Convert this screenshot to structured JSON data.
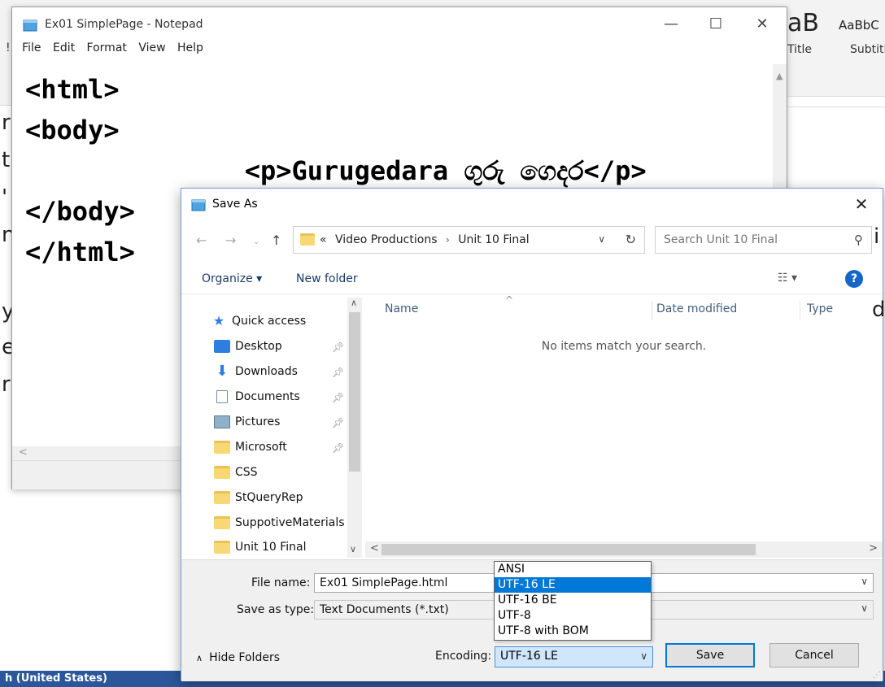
{
  "word": {
    "style_preview_1": "aB",
    "style_preview_2": "AaBbC",
    "style_name_1": "Title",
    "style_name_2": "Subtitl",
    "status_text": "h (United States)",
    "left_frags": [
      "r",
      "t",
      "'",
      "n",
      "y",
      "e",
      "r"
    ],
    "right_frags": [
      "i",
      "d"
    ]
  },
  "notepad": {
    "title": "Ex01 SimplePage - Notepad",
    "menu": [
      "File",
      "Edit",
      "Format",
      "View",
      "Help"
    ],
    "menu_marker": "!",
    "content_lines": [
      "<html>",
      "<body>",
      "              <p>Gurugedara ගුරු ගෙදර</p>",
      "</body>",
      "</html>"
    ]
  },
  "dialog": {
    "title": "Save As",
    "address": {
      "prefix": "«",
      "crumbs": [
        "Video Productions",
        "Unit 10 Final"
      ]
    },
    "search_placeholder": "Search Unit 10 Final",
    "toolbar": {
      "organize": "Organize ▾",
      "new_folder": "New folder",
      "help": "?"
    },
    "nav_items": [
      {
        "label": "Quick access",
        "icon": "star-icon",
        "pinned": false
      },
      {
        "label": "Desktop",
        "icon": "desktop-icon",
        "pinned": true
      },
      {
        "label": "Downloads",
        "icon": "download-icon",
        "pinned": true
      },
      {
        "label": "Documents",
        "icon": "documents-icon",
        "pinned": true
      },
      {
        "label": "Pictures",
        "icon": "pictures-icon",
        "pinned": true
      },
      {
        "label": "Microsoft",
        "icon": "folder-icon",
        "pinned": true
      },
      {
        "label": "CSS",
        "icon": "folder-icon",
        "pinned": false
      },
      {
        "label": "StQueryRep",
        "icon": "folder-icon",
        "pinned": false
      },
      {
        "label": "SuppotiveMaterials",
        "icon": "folder-icon",
        "pinned": false
      },
      {
        "label": "Unit 10 Final",
        "icon": "folder-icon",
        "pinned": false
      }
    ],
    "columns": [
      "Name",
      "Date modified",
      "Type"
    ],
    "empty_message": "No items match your search.",
    "file_name_label": "File name:",
    "file_name_value": "Ex01 SimplePage.html",
    "save_type_label": "Save as type:",
    "save_type_value": "Text Documents (*.txt)",
    "encoding_label": "Encoding:",
    "encoding_value": "UTF-16 LE",
    "encoding_options": [
      "ANSI",
      "UTF-16 LE",
      "UTF-16 BE",
      "UTF-8",
      "UTF-8 with BOM"
    ],
    "encoding_selected_index": 1,
    "hide_folders": "Hide Folders",
    "save_button": "Save",
    "cancel_button": "Cancel"
  },
  "colors": {
    "accent": "#0078d7",
    "word_status": "#2b579a",
    "folder": "#f8d775"
  }
}
